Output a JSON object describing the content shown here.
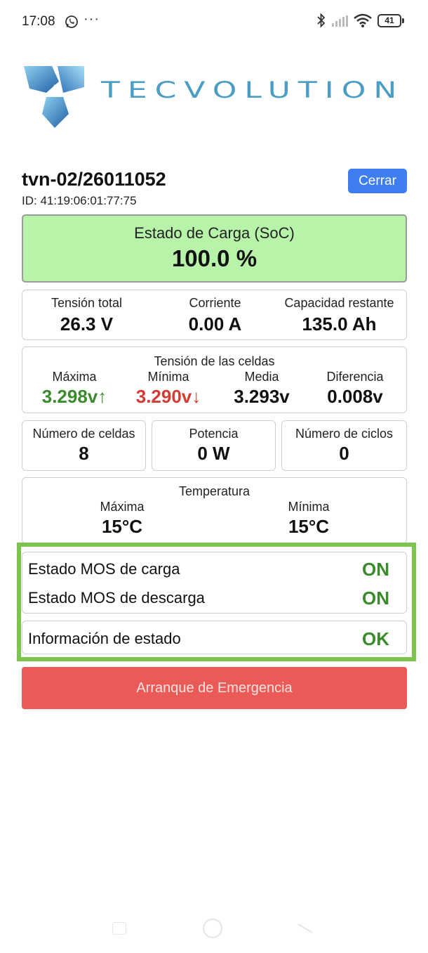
{
  "status_bar": {
    "time": "17:08",
    "notification_icons": [
      "whatsapp-icon"
    ],
    "more": "···",
    "system_icons": [
      "bluetooth-icon",
      "signal-icon",
      "wifi-icon"
    ],
    "battery": "41"
  },
  "logo": {
    "brand_text": "TECVOLUTION",
    "colors": {
      "primary": "#4a9ec5",
      "dark": "#1f5fa6"
    }
  },
  "device": {
    "name": "tvn-02/26011052",
    "id": "ID: 41:19:06:01:77:75",
    "close_label": "Cerrar"
  },
  "soc": {
    "label": "Estado de Carga (SoC)",
    "value": "100.0 %"
  },
  "metrics": [
    {
      "label": "Tensión total",
      "value": "26.3 V"
    },
    {
      "label": "Corriente",
      "value": "0.00 A"
    },
    {
      "label": "Capacidad restante",
      "value": "135.0 Ah"
    }
  ],
  "cells": {
    "title": "Tensión de las celdas",
    "items": [
      {
        "label": "Máxima",
        "value": "3.298v↑"
      },
      {
        "label": "Mínima",
        "value": "3.290v↓"
      },
      {
        "label": "Media",
        "value": "3.293v"
      },
      {
        "label": "Diferencia",
        "value": "0.008v"
      }
    ]
  },
  "counts": [
    {
      "label": "Número de celdas",
      "value": "8"
    },
    {
      "label": "Potencia",
      "value": "0 W"
    },
    {
      "label": "Número de ciclos",
      "value": "0"
    }
  ],
  "temperature": {
    "title": "Temperatura",
    "items": [
      {
        "label": "Máxima",
        "value": "15°C"
      },
      {
        "label": "Mínima",
        "value": "15°C"
      }
    ]
  },
  "mos": {
    "charge_label": "Estado MOS de carga",
    "charge_value": "ON",
    "discharge_label": "Estado MOS de descarga",
    "discharge_value": "ON",
    "info_label": "Información de estado",
    "info_value": "OK"
  },
  "emergency_label": "Arranque de Emergencia",
  "colors": {
    "accent_button": "#3f7ef2",
    "soc_bg": "#b7f3a8",
    "ok_green": "#3a8b2c",
    "warn_red": "#d23c33",
    "highlight_border": "#7cc44d",
    "emergency": "#ea5b57"
  }
}
